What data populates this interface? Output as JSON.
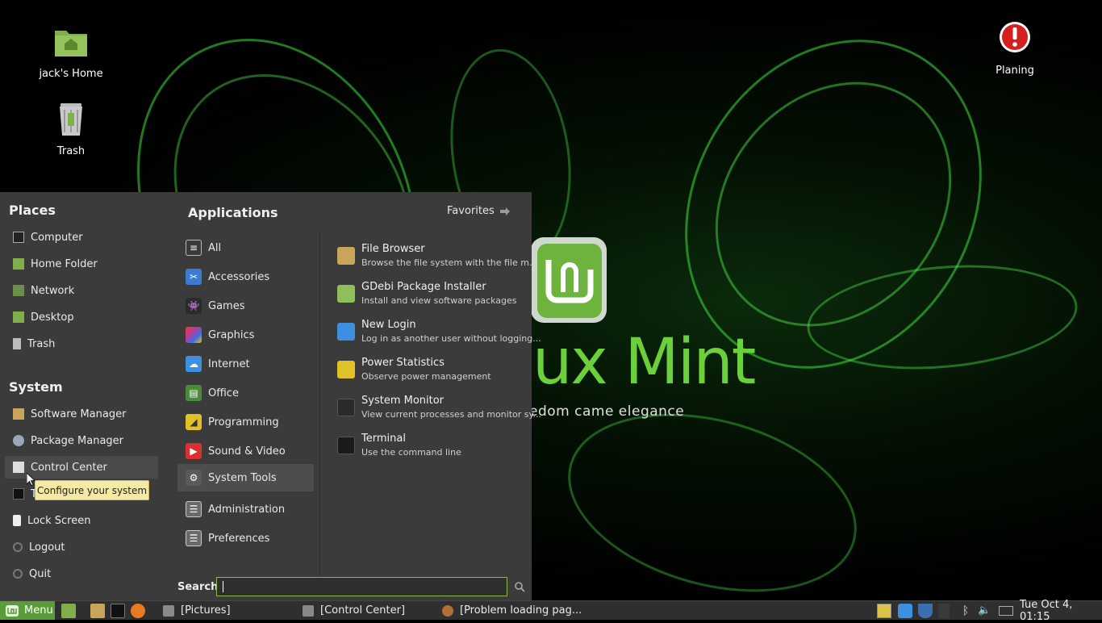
{
  "desktop": {
    "icons": [
      {
        "label": "jack's Home",
        "icon": "home-folder-icon"
      },
      {
        "label": "Trash",
        "icon": "trash-icon"
      },
      {
        "label": "Planing",
        "icon": "warning-icon"
      }
    ],
    "wallpaper": {
      "brand_suffix": "ux Mint",
      "tagline": "edom came elegance"
    }
  },
  "menu": {
    "places_title": "Places",
    "places": [
      {
        "label": "Computer",
        "icon": "computer-icon"
      },
      {
        "label": "Home Folder",
        "icon": "home-folder-icon"
      },
      {
        "label": "Network",
        "icon": "network-icon"
      },
      {
        "label": "Desktop",
        "icon": "desktop-icon"
      },
      {
        "label": "Trash",
        "icon": "trash-icon"
      }
    ],
    "system_title": "System",
    "system": [
      {
        "label": "Software Manager",
        "icon": "software-manager-icon"
      },
      {
        "label": "Package Manager",
        "icon": "package-manager-icon"
      },
      {
        "label": "Control Center",
        "icon": "control-center-icon"
      },
      {
        "label": "T",
        "icon": "terminal-icon"
      },
      {
        "label": "Lock Screen",
        "icon": "lock-icon"
      },
      {
        "label": "Logout",
        "icon": "logout-icon"
      },
      {
        "label": "Quit",
        "icon": "power-icon"
      }
    ],
    "tooltip": "Configure your system",
    "applications_title": "Applications",
    "favorites_label": "Favorites",
    "categories": [
      {
        "label": "All",
        "color": "#3a3a3a"
      },
      {
        "label": "Accessories",
        "color": "#3b7bd4"
      },
      {
        "label": "Games",
        "color": "#2b2b2b"
      },
      {
        "label": "Graphics",
        "color": "#c0398a"
      },
      {
        "label": "Internet",
        "color": "#3d8fe0"
      },
      {
        "label": "Office",
        "color": "#4a8a3a"
      },
      {
        "label": "Programming",
        "color": "#e0c12a"
      },
      {
        "label": "Sound & Video",
        "color": "#d93030"
      },
      {
        "label": "System Tools",
        "color": "#5a5a5a"
      },
      {
        "label": "Administration",
        "color": "#6a6a6a"
      },
      {
        "label": "Preferences",
        "color": "#6a6a6a"
      }
    ],
    "selected_category": "System Tools",
    "apps": [
      {
        "name": "File Browser",
        "desc": "Browse the file system with the file m...",
        "color": "#c9a55a"
      },
      {
        "name": "GDebi Package Installer",
        "desc": "Install and view software packages",
        "color": "#8fbf5a"
      },
      {
        "name": "New Login",
        "desc": "Log in as another user without logging...",
        "color": "#3d8fe0"
      },
      {
        "name": "Power Statistics",
        "desc": "Observe power management",
        "color": "#e0c12a"
      },
      {
        "name": "System Monitor",
        "desc": "View current processes and monitor sy...",
        "color": "#2a2a2a"
      },
      {
        "name": "Terminal",
        "desc": "Use the command line",
        "color": "#1a1a1a"
      }
    ],
    "search_label": "Search:",
    "search_value": ""
  },
  "taskbar": {
    "menu_label": "Menu",
    "windows": [
      {
        "label": "[Pictures]"
      },
      {
        "label": "[Control Center]"
      },
      {
        "label": "[Problem loading pag..."
      }
    ],
    "clock": "Tue Oct  4, 01:15"
  }
}
